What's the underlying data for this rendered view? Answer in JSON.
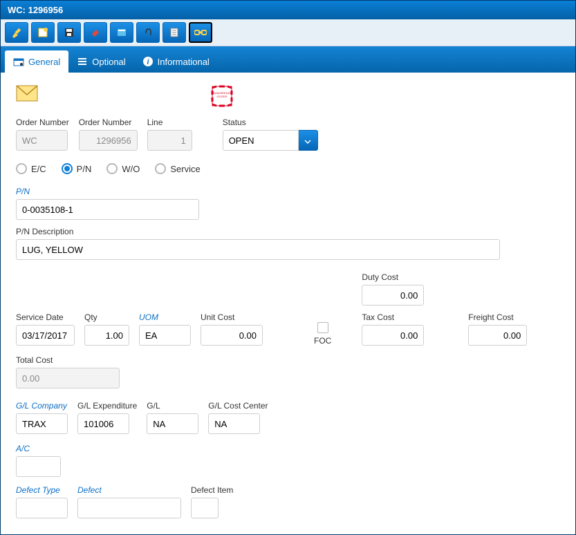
{
  "window": {
    "title": "WC: 1296956"
  },
  "tabs": {
    "general": "General",
    "optional": "Optional",
    "informational": "Informational"
  },
  "labels": {
    "orderNumberPrefix": "Order Number",
    "orderNumber": "Order Number",
    "line": "Line",
    "status": "Status",
    "pn": "P/N",
    "pnDesc": "P/N Description",
    "serviceDate": "Service Date",
    "qty": "Qty",
    "uom": "UOM",
    "unitCost": "Unit Cost",
    "foc": "FOC",
    "dutyCost": "Duty Cost",
    "taxCost": "Tax Cost",
    "freightCost": "Freight Cost",
    "totalCost": "Total Cost",
    "glCompany": "G/L Company",
    "glExpenditure": "G/L Expenditure",
    "gl": "G/L",
    "glCostCenter": "G/L Cost Center",
    "ac": "A/C",
    "defectType": "Defect Type",
    "defect": "Defect",
    "defectItem": "Defect Item"
  },
  "radios": {
    "ec": "E/C",
    "pn": "P/N",
    "wo": "W/O",
    "service": "Service",
    "selected": "pn"
  },
  "values": {
    "orderPrefix": "WC",
    "orderNumber": "1296956",
    "line": "1",
    "status": "OPEN",
    "pn": "0-0035108-1",
    "pnDesc": "LUG, YELLOW",
    "serviceDate": "03/17/2017",
    "qty": "1.00",
    "uom": "EA",
    "unitCost": "0.00",
    "dutyCost": "0.00",
    "taxCost": "0.00",
    "freightCost": "0.00",
    "totalCost": "0.00",
    "glCompany": "TRAX",
    "glExpenditure": "101006",
    "gl": "NA",
    "glCostCenter": "NA",
    "ac": "",
    "defectType": "",
    "defect": "",
    "defectItem": ""
  }
}
